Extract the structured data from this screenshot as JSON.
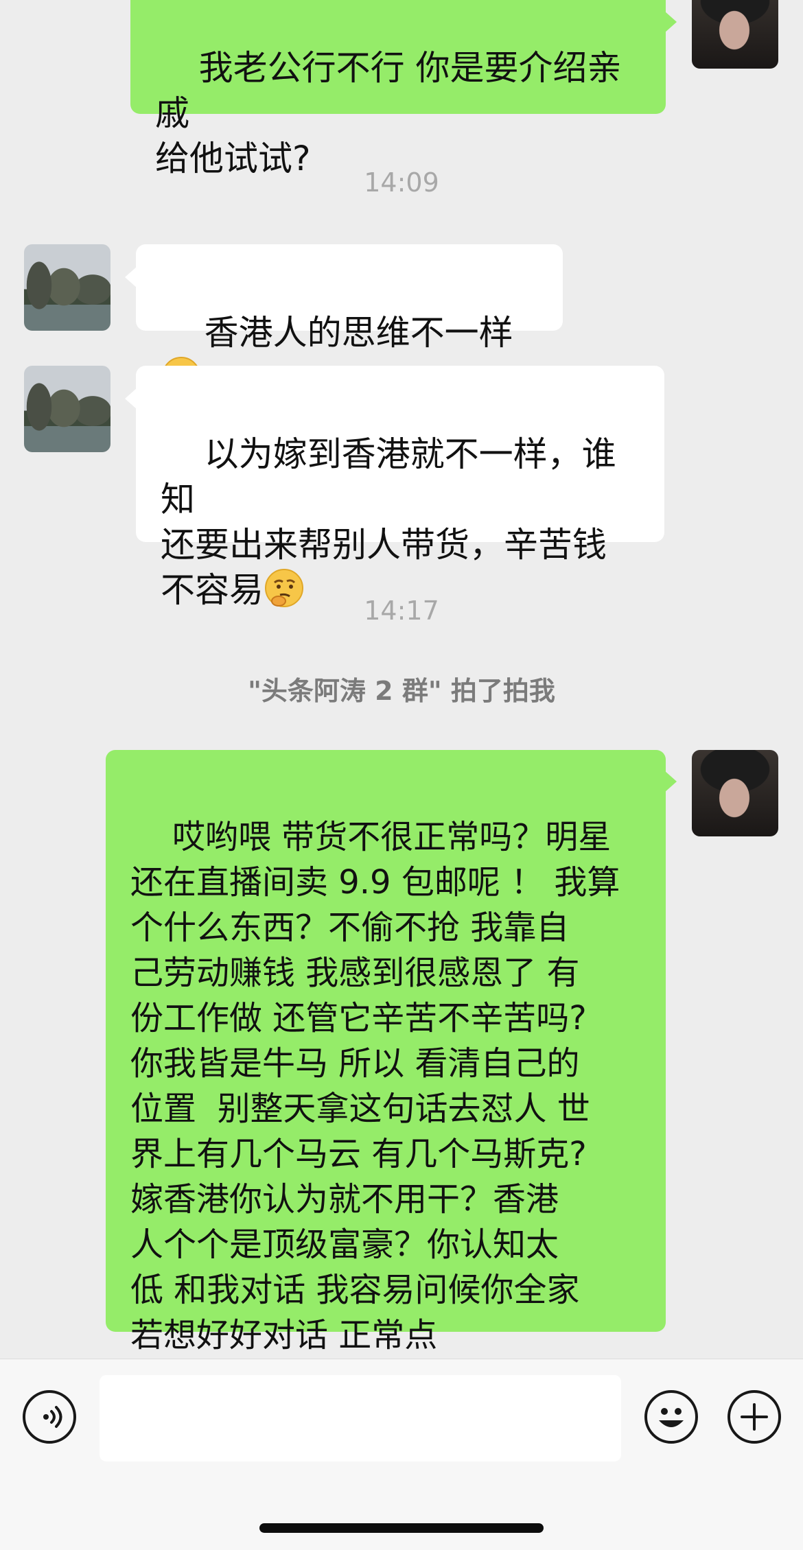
{
  "messages": [
    {
      "sender": "self",
      "text": "我老公行不行 你是要介绍亲戚\n给他试试?"
    },
    {
      "sender": "other",
      "text": "香港人的思维不一样",
      "emoji": "thinking-face"
    },
    {
      "sender": "other",
      "text": "以为嫁到香港就不一样，谁知\n还要出来帮别人带货，辛苦钱\n不容易",
      "emoji": "thinking-face"
    },
    {
      "sender": "self",
      "text": "哎哟喂 带货不很正常吗？明星\n还在直播间卖 9.9 包邮呢 ！ 我算\n个什么东西？不偷不抢 我靠自\n己劳动赚钱 我感到很感恩了 有\n份工作做 还管它辛苦不辛苦吗?\n你我皆是牛马 所以 看清自己的\n位置  别整天拿这句话去怼人 世\n界上有几个马云 有几个马斯克?\n嫁香港你认为就不用干？香港\n人个个是顶级富豪？你认知太\n低 和我对话 我容易问候你全家\n若想好好对话 正常点"
    }
  ],
  "timestamps": [
    "14:09",
    "14:17"
  ],
  "system_notice": "\"头条阿涛 2 群\" 拍了拍我",
  "input_bar": {
    "icons": [
      "voice-icon",
      "emoji-icon",
      "plus-icon"
    ],
    "text_value": ""
  },
  "colors": {
    "background": "#ededed",
    "self_bubble": "#95ec69",
    "other_bubble": "#ffffff",
    "timestamp": "#a8a8a8"
  }
}
